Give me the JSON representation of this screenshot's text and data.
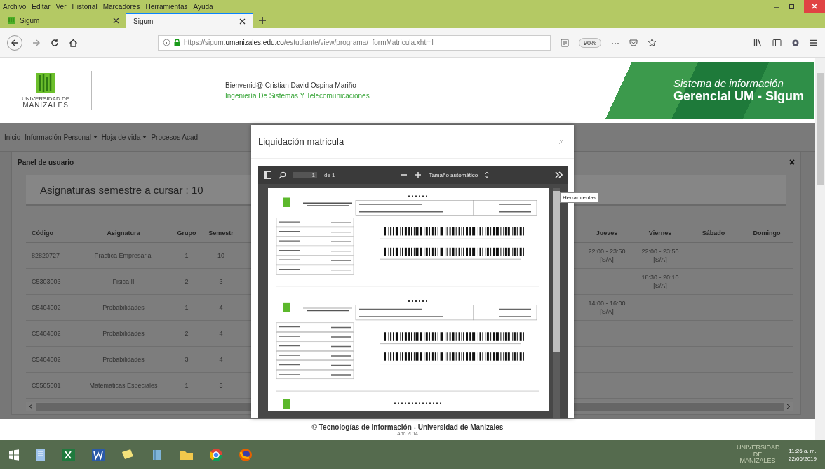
{
  "browser": {
    "menu": [
      "Archivo",
      "Editar",
      "Ver",
      "Historial",
      "Marcadores",
      "Herramientas",
      "Ayuda"
    ],
    "tabs": [
      {
        "label": "Sigum",
        "selected": false
      },
      {
        "label": "Sigum",
        "selected": true
      }
    ],
    "url": {
      "prefix": "https://sigum.",
      "host": "umanizales.edu.co",
      "path": "/estudiante/view/programa/_formMatricula.xhtml"
    },
    "zoom": "90%",
    "more": "···"
  },
  "header": {
    "logo_lines": [
      "UNIVERSIDAD DE",
      "MANIZALES"
    ],
    "welcome": "Bienvenid@ Cristian David Ospina Mariño",
    "program": "Ingeniería De Sistemas Y Telecomunicaciones",
    "banner_line1": "Sistema de información",
    "banner_line2": "Gerencial UM - Sigum"
  },
  "nav": [
    {
      "label": "Inicio",
      "dropdown": false
    },
    {
      "label": "Información Personal",
      "dropdown": true
    },
    {
      "label": "Hoja de vida",
      "dropdown": true
    },
    {
      "label": "Procesos Acad",
      "dropdown": false
    }
  ],
  "panel": {
    "title": "Panel de usuario",
    "summary": "Asignaturas semestre a cursar : 10"
  },
  "table": {
    "left_columns": [
      "Código",
      "Asignatura",
      "Grupo",
      "Semestr"
    ],
    "right_columns": [
      "Jueves",
      "Viernes",
      "Sábado",
      "Domingo"
    ],
    "rows": [
      {
        "code": "82820727",
        "subject": "Practica Empresarial",
        "group": "1",
        "semester": "10",
        "jueves": {
          "time": "22:00 - 23:50",
          "room": "[S/A]"
        },
        "viernes": {
          "time": "22:00 - 23:50",
          "room": "[S/A]"
        }
      },
      {
        "code": "C5303003",
        "subject": "Fisica II",
        "group": "2",
        "semester": "3",
        "viernes": {
          "time": "18:30 - 20:10",
          "room": "[S/A]"
        }
      },
      {
        "code": "C5404002",
        "subject": "Probabilidades",
        "group": "1",
        "semester": "4",
        "jueves": {
          "time": "14:00 - 16:00",
          "room": "[S/A]"
        }
      },
      {
        "code": "C5404002",
        "subject": "Probabilidades",
        "group": "2",
        "semester": "4"
      },
      {
        "code": "C5404002",
        "subject": "Probabilidades",
        "group": "3",
        "semester": "4"
      },
      {
        "code": "C5505001",
        "subject": "Matematicas Especiales",
        "group": "1",
        "semester": "5"
      }
    ]
  },
  "modal": {
    "title": "Liquidación matricula",
    "pdf": {
      "page": "1",
      "of": "de 1",
      "scale": "Tamaño automático",
      "tooltip": "Herramientas"
    }
  },
  "footer": {
    "copyright": "© Tecnologías de Información - Universidad de Manizales",
    "year": "Año 2014"
  },
  "taskbar": {
    "brand": "UNIVERSIDAD DE MANIZALES",
    "time": "11:26 a. m.",
    "date": "22/06/2019"
  }
}
